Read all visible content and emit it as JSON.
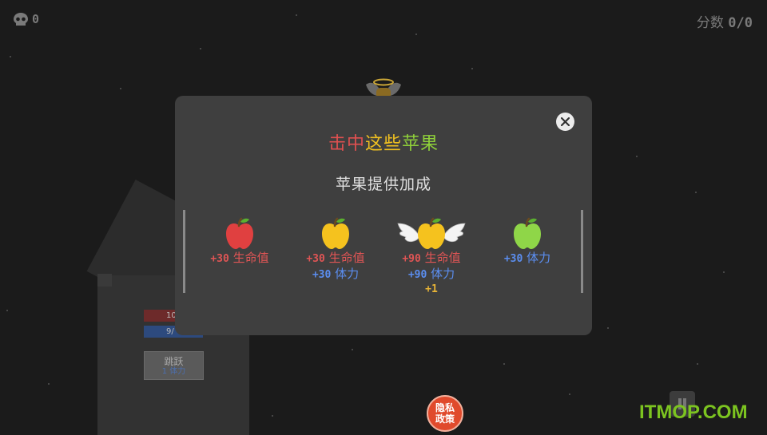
{
  "hud": {
    "skull_count": "0",
    "score_label": "分数",
    "score_value": "0/0"
  },
  "background": {
    "hp_bar_text": "10",
    "stamina_bar_text": "9/",
    "jump_button": {
      "label": "跳跃",
      "cost": "1 体力"
    }
  },
  "modal": {
    "title_parts": [
      {
        "text": "击中",
        "color": "#e05050"
      },
      {
        "text": "这些",
        "color": "#f0c020"
      },
      {
        "text": "苹果",
        "color": "#8fd03a"
      }
    ],
    "subtitle": "苹果提供加成",
    "apples": [
      {
        "icon": "red-apple-icon",
        "color": "#e04040",
        "effects": [
          {
            "num": "+30",
            "label": "生命值",
            "color": "red"
          }
        ],
        "bonus": ""
      },
      {
        "icon": "yellow-apple-icon",
        "color": "#f5c21e",
        "effects": [
          {
            "num": "+30",
            "label": "生命值",
            "color": "red"
          },
          {
            "num": "+30",
            "label": "体力",
            "color": "blue"
          }
        ],
        "bonus": ""
      },
      {
        "icon": "winged-golden-apple-icon",
        "color": "#f5c21e",
        "effects": [
          {
            "num": "+90",
            "label": "生命值",
            "color": "red"
          },
          {
            "num": "+90",
            "label": "体力",
            "color": "blue"
          }
        ],
        "bonus": "+1"
      },
      {
        "icon": "green-apple-icon",
        "color": "#8fd648",
        "effects": [
          {
            "num": "+30",
            "label": "体力",
            "color": "blue"
          }
        ],
        "bonus": ""
      }
    ]
  },
  "privacy_button": {
    "line1": "隐私",
    "line2": "政策"
  },
  "watermark": "ITMOP.COM"
}
